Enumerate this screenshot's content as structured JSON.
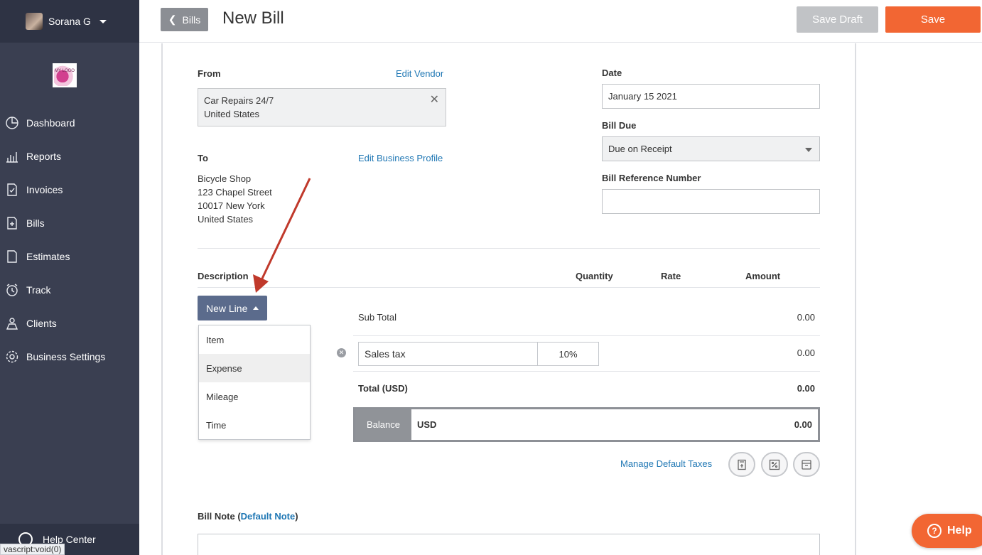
{
  "user": {
    "name": "Sorana G"
  },
  "logo_text": "MY LOGO",
  "sidebar": {
    "items": [
      {
        "label": "Dashboard",
        "icon": "dashboard-icon"
      },
      {
        "label": "Reports",
        "icon": "reports-icon"
      },
      {
        "label": "Invoices",
        "icon": "invoices-icon"
      },
      {
        "label": "Bills",
        "icon": "bills-icon"
      },
      {
        "label": "Estimates",
        "icon": "estimates-icon"
      },
      {
        "label": "Track",
        "icon": "track-icon"
      },
      {
        "label": "Clients",
        "icon": "clients-icon"
      },
      {
        "label": "Business Settings",
        "icon": "settings-icon"
      }
    ],
    "help_center": "Help Center"
  },
  "status_bar": "vascript:void(0)",
  "header": {
    "back_label": "Bills",
    "title": "New Bill",
    "save_draft": "Save Draft",
    "save": "Save"
  },
  "from": {
    "label": "From",
    "edit_link": "Edit Vendor",
    "vendor_line1": "Car Repairs 24/7",
    "vendor_line2": "United States"
  },
  "to": {
    "label": "To",
    "edit_link": "Edit Business Profile",
    "line1": "Bicycle Shop",
    "line2": "123 Chapel Street",
    "line3": "10017 New York",
    "line4": "United States"
  },
  "date": {
    "label": "Date",
    "value": "January 15 2021"
  },
  "bill_due": {
    "label": "Bill Due",
    "value": "Due on Receipt"
  },
  "bill_ref": {
    "label": "Bill Reference Number",
    "value": ""
  },
  "columns": {
    "description": "Description",
    "quantity": "Quantity",
    "rate": "Rate",
    "amount": "Amount"
  },
  "new_line": {
    "label": "New Line",
    "options": [
      "Item",
      "Expense",
      "Mileage",
      "Time"
    ],
    "highlighted": "Expense"
  },
  "totals": {
    "subtotal_label": "Sub Total",
    "subtotal_value": "0.00",
    "tax_name": "Sales tax",
    "tax_rate": "10%",
    "tax_value": "0.00",
    "total_label": "Total (USD)",
    "total_value": "0.00",
    "balance_label": "Balance",
    "balance_currency": "USD",
    "balance_value": "0.00"
  },
  "manage_taxes": "Manage Default Taxes",
  "bill_note": {
    "label": "Bill Note (",
    "link": "Default Note",
    "close": ")"
  },
  "help_button": "Help",
  "colors": {
    "accent": "#f26633",
    "sidebar": "#3a3f51",
    "link": "#1f77b4",
    "new_line": "#5b6b8c",
    "arrow": "#c0392b"
  }
}
